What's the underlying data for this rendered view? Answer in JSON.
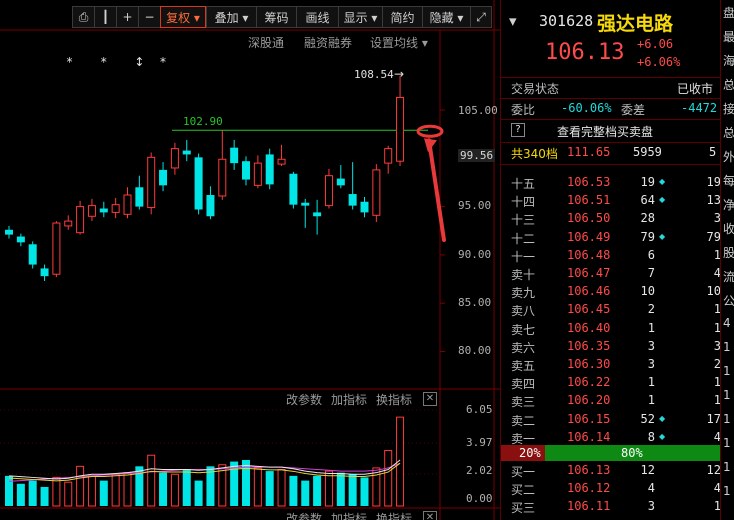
{
  "toolbar": {
    "items": [
      {
        "label": "⎙",
        "icon": "refresh-icon"
      },
      {
        "label": "┃",
        "icon": "cursor-icon"
      },
      {
        "label": "+",
        "icon": "zoom-in-icon"
      },
      {
        "label": "−",
        "icon": "zoom-out-icon"
      },
      {
        "label": "复权 ▾",
        "active": true
      },
      {
        "label": "叠加 ▾"
      },
      {
        "label": "筹码"
      },
      {
        "label": "画线"
      },
      {
        "label": "显示 ▾"
      },
      {
        "label": "简约"
      },
      {
        "label": "隐藏 ▾"
      },
      {
        "label": "⤢",
        "icon": "expand-icon"
      }
    ]
  },
  "subbar": {
    "shengu": "深股通",
    "rongzi": "融资融券",
    "junxian": "设置均线 ▾"
  },
  "markers": [
    "*",
    "*",
    "↕",
    "*"
  ],
  "price_labels": {
    "high": "108.54",
    "line": "102.90",
    "current": "99.56"
  },
  "price_axis": [
    "105.00",
    "95.00",
    "90.00",
    "85.00",
    "80.00"
  ],
  "indicator_bar_1": {
    "params": "改参数",
    "add": "加指标",
    "swap": "换指标",
    "close": "✕"
  },
  "indicator_bar_2": {
    "params": "改参数",
    "add": "加指标",
    "swap": "换指标",
    "close": "✕"
  },
  "vol_axis": [
    "6.05",
    "3.97",
    "2.02",
    "0.00"
  ],
  "chart_data": {
    "type": "candlestick",
    "price_range": [
      77,
      112
    ],
    "candles": [
      {
        "o": 92.6,
        "c": 92.1,
        "h": 93.0,
        "l": 91.7
      },
      {
        "o": 91.9,
        "c": 91.3,
        "h": 92.2,
        "l": 90.9
      },
      {
        "o": 91.1,
        "c": 89.0,
        "h": 91.4,
        "l": 88.6
      },
      {
        "o": 88.6,
        "c": 87.8,
        "h": 89.0,
        "l": 87.3
      },
      {
        "o": 88.0,
        "c": 93.3,
        "h": 93.5,
        "l": 87.7
      },
      {
        "o": 93.0,
        "c": 93.5,
        "h": 94.1,
        "l": 92.6
      },
      {
        "o": 92.3,
        "c": 95.0,
        "h": 95.6,
        "l": 92.1
      },
      {
        "o": 94.0,
        "c": 95.1,
        "h": 95.8,
        "l": 93.5
      },
      {
        "o": 94.8,
        "c": 94.4,
        "h": 95.5,
        "l": 93.9
      },
      {
        "o": 94.4,
        "c": 95.2,
        "h": 95.9,
        "l": 93.8
      },
      {
        "o": 94.2,
        "c": 96.2,
        "h": 97.0,
        "l": 93.8
      },
      {
        "o": 97.0,
        "c": 95.0,
        "h": 98.2,
        "l": 94.7
      },
      {
        "o": 94.9,
        "c": 100.1,
        "h": 100.6,
        "l": 94.2
      },
      {
        "o": 98.8,
        "c": 97.2,
        "h": 99.6,
        "l": 96.6
      },
      {
        "o": 99.0,
        "c": 101.0,
        "h": 101.6,
        "l": 98.3
      },
      {
        "o": 100.8,
        "c": 100.4,
        "h": 101.9,
        "l": 99.7
      },
      {
        "o": 100.1,
        "c": 94.7,
        "h": 100.5,
        "l": 94.2
      },
      {
        "o": 96.2,
        "c": 94.0,
        "h": 97.1,
        "l": 93.7
      },
      {
        "o": 96.1,
        "c": 99.9,
        "h": 102.9,
        "l": 95.7
      },
      {
        "o": 101.1,
        "c": 99.5,
        "h": 101.9,
        "l": 98.8
      },
      {
        "o": 99.7,
        "c": 97.8,
        "h": 100.2,
        "l": 97.2
      },
      {
        "o": 97.2,
        "c": 99.5,
        "h": 100.3,
        "l": 96.9
      },
      {
        "o": 100.4,
        "c": 97.3,
        "h": 101.0,
        "l": 96.8
      },
      {
        "o": 99.4,
        "c": 99.9,
        "h": 101.4,
        "l": 99.2
      },
      {
        "o": 98.4,
        "c": 95.2,
        "h": 98.6,
        "l": 94.8
      },
      {
        "o": 95.4,
        "c": 95.1,
        "h": 95.8,
        "l": 92.8
      },
      {
        "o": 94.4,
        "c": 94.0,
        "h": 95.7,
        "l": 92.1
      },
      {
        "o": 95.1,
        "c": 98.2,
        "h": 98.9,
        "l": 94.8
      },
      {
        "o": 97.9,
        "c": 97.2,
        "h": 99.3,
        "l": 96.9
      },
      {
        "o": 96.3,
        "c": 95.1,
        "h": 99.6,
        "l": 94.7
      },
      {
        "o": 95.5,
        "c": 94.4,
        "h": 96.0,
        "l": 93.9
      },
      {
        "o": 94.1,
        "c": 98.8,
        "h": 99.4,
        "l": 93.4
      },
      {
        "o": 99.5,
        "c": 101.0,
        "h": 101.3,
        "l": 98.4
      },
      {
        "o": 99.7,
        "c": 106.3,
        "h": 108.54,
        "l": 99.2
      }
    ],
    "volumes": [
      1.9,
      1.4,
      1.6,
      1.2,
      1.8,
      1.5,
      2.5,
      1.9,
      1.6,
      2.0,
      2.1,
      2.5,
      3.2,
      2.1,
      2.0,
      2.3,
      1.6,
      2.5,
      2.6,
      2.8,
      2.9,
      2.4,
      2.2,
      2.3,
      1.9,
      1.6,
      1.9,
      2.2,
      2.1,
      2.0,
      1.8,
      2.4,
      3.5,
      5.6
    ],
    "ma": [
      1.9,
      1.85,
      1.8,
      1.75,
      1.7,
      1.75,
      1.9,
      2.0,
      2.0,
      2.05,
      2.1,
      2.2,
      2.35,
      2.3,
      2.3,
      2.3,
      2.25,
      2.3,
      2.4,
      2.5,
      2.55,
      2.5,
      2.45,
      2.45,
      2.35,
      2.2,
      2.1,
      2.05,
      2.05,
      2.0,
      2.0,
      2.1,
      2.3,
      2.9
    ],
    "ma2": [
      1.55,
      1.6,
      1.65,
      1.7,
      1.75,
      1.8,
      1.85,
      1.9,
      1.95,
      2.0,
      2.05,
      2.1,
      2.15,
      2.2,
      2.25,
      2.3,
      2.3,
      2.3,
      2.35,
      2.4,
      2.45,
      2.45,
      2.45,
      2.45,
      2.4,
      2.35,
      2.3,
      2.25,
      2.2,
      2.2,
      2.2,
      2.25,
      2.4,
      2.7
    ],
    "vol_range": [
      0,
      6.05
    ]
  },
  "stock": {
    "code": "301628",
    "name": "强达电路",
    "price": "106.13",
    "change": "+6.06",
    "pct": "+6.06%"
  },
  "status": {
    "label": "交易状态",
    "value": "已收市"
  },
  "ratio": {
    "label1": "委比",
    "v1": "-60.06%",
    "label2": "委差",
    "v2": "-4472"
  },
  "full_depth": "查看完整档买卖盘",
  "total": {
    "label": "共340档",
    "price": "111.65",
    "vol": "5959",
    "n": "5"
  },
  "asks": [
    {
      "label": "十五",
      "price": "106.53",
      "vol": "19",
      "dot": true,
      "n": "19"
    },
    {
      "label": "十四",
      "price": "106.51",
      "vol": "64",
      "dot": true,
      "n": "13"
    },
    {
      "label": "十三",
      "price": "106.50",
      "vol": "28",
      "dot": false,
      "n": "3"
    },
    {
      "label": "十二",
      "price": "106.49",
      "vol": "79",
      "dot": true,
      "n": "79"
    },
    {
      "label": "十一",
      "price": "106.48",
      "vol": "6",
      "dot": false,
      "n": "1"
    },
    {
      "label": "卖十",
      "price": "106.47",
      "vol": "7",
      "dot": false,
      "n": "4"
    },
    {
      "label": "卖九",
      "price": "106.46",
      "vol": "10",
      "dot": false,
      "n": "10"
    },
    {
      "label": "卖八",
      "price": "106.45",
      "vol": "2",
      "dot": false,
      "n": "1"
    },
    {
      "label": "卖七",
      "price": "106.40",
      "vol": "1",
      "dot": false,
      "n": "1"
    },
    {
      "label": "卖六",
      "price": "106.35",
      "vol": "3",
      "dot": false,
      "n": "3"
    },
    {
      "label": "卖五",
      "price": "106.30",
      "vol": "3",
      "dot": false,
      "n": "2"
    },
    {
      "label": "卖四",
      "price": "106.22",
      "vol": "1",
      "dot": false,
      "n": "1"
    },
    {
      "label": "卖三",
      "price": "106.20",
      "vol": "1",
      "dot": false,
      "n": "1"
    },
    {
      "label": "卖二",
      "price": "106.15",
      "vol": "52",
      "dot": true,
      "n": "17"
    },
    {
      "label": "卖一",
      "price": "106.14",
      "vol": "8",
      "dot": true,
      "n": "4"
    }
  ],
  "strength": {
    "sell": "20%",
    "buy": "80%",
    "sell_frac": 0.2
  },
  "bids": [
    {
      "label": "买一",
      "price": "106.13",
      "vol": "12",
      "dot": false,
      "n": "12"
    },
    {
      "label": "买二",
      "price": "106.12",
      "vol": "4",
      "dot": false,
      "n": "4"
    },
    {
      "label": "买三",
      "price": "106.11",
      "vol": "3",
      "dot": false,
      "n": "1"
    }
  ],
  "edge_chars": [
    "盘",
    "最",
    "海",
    "总",
    "接",
    "总",
    "外",
    "每",
    "净",
    "收",
    "股",
    "流",
    "公",
    "4",
    "1",
    "1",
    "1",
    "1",
    "1",
    "1",
    "1"
  ],
  "colors": {
    "up": "#ff3a3a",
    "down": "#00e5e5",
    "ma1": "#e8e8e8",
    "ma2": "#d63fd6",
    "ma3": "#e8d23a",
    "hline": "#27c42a",
    "annot": "#e83a3a"
  }
}
